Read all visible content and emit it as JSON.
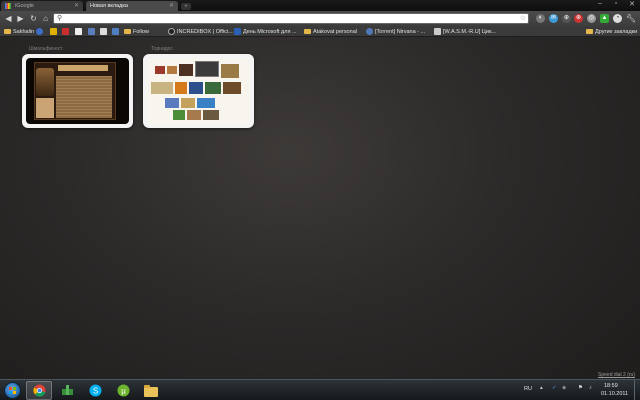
{
  "tabs": [
    {
      "label": "iGoogle"
    },
    {
      "label": "Новая вкладка"
    }
  ],
  "omnibox": {
    "value": ""
  },
  "bookmarks": {
    "items": [
      {
        "label": "Sakhalin"
      },
      {
        "label": "Follow"
      },
      {
        "label": "INCREDIBOX | Offici..."
      },
      {
        "label": "День Microsoft для ..."
      },
      {
        "label": "Atakovat personal"
      },
      {
        "label": "[Torrent] Nirvana - ..."
      },
      {
        "label": "[W.A.S.M.-R.U] Цик..."
      }
    ],
    "other": "Другие закладки"
  },
  "thumbnails": [
    {
      "title": "Шмальфинест"
    },
    {
      "title": "Торнадос"
    }
  ],
  "speed_dial": {
    "label": "Speed dial 2 (ru)"
  },
  "taskbar": {
    "lang": "RU",
    "time": "18:59",
    "date": "01.10.2011"
  },
  "colors": {
    "page_bg": "#2c2a29",
    "tab_active": "#4a4a4a",
    "toolbar": "#444444",
    "folder": "#e3b74a"
  }
}
